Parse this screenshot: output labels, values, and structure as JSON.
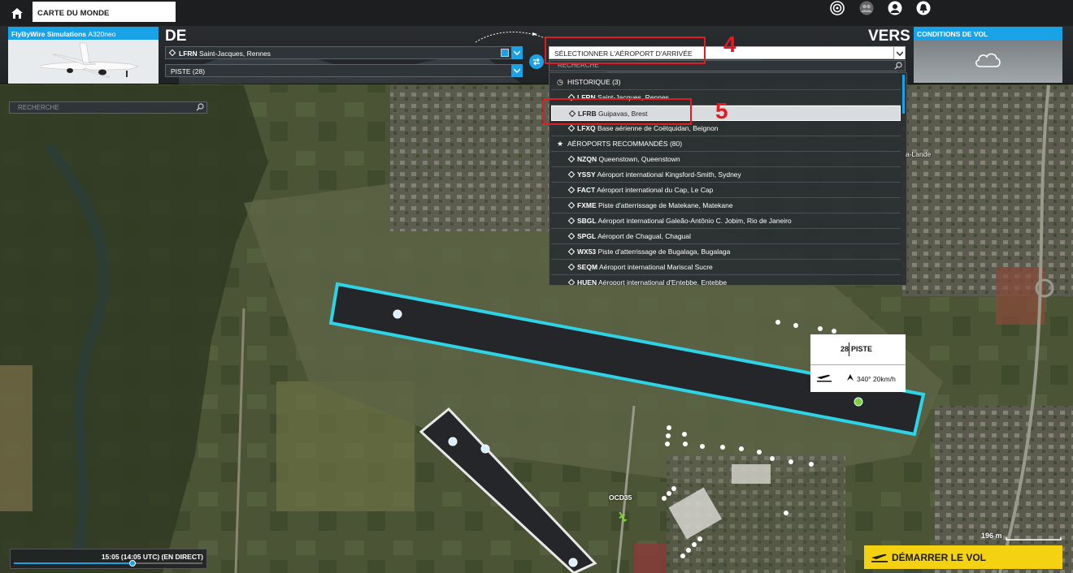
{
  "topbar": {
    "tab_label": "CARTE DU MONDE",
    "icons": [
      "home-icon",
      "activity-icon",
      "users-icon",
      "profile-icon",
      "notifications-icon"
    ]
  },
  "aircraft": {
    "maker": "FlyByWire Simulations",
    "model": "A320neo"
  },
  "departure": {
    "heading": "DE",
    "airport_icao": "LFRN",
    "airport_name": "Saint-Jacques, Rennes",
    "runway": "PISTE (28)"
  },
  "arrival": {
    "heading": "VERS",
    "select_label": "SÉLECTIONNER L'AÉROPORT D'ARRIVÉE",
    "search_placeholder": "RECHERCHE"
  },
  "dropdown": {
    "history_header": "HISTORIQUE (3)",
    "recommended_header": "AÉROPORTS RECOMMANDÉS (80)",
    "history": [
      {
        "icao": "LFRN",
        "name": "Saint-Jacques, Rennes"
      },
      {
        "icao": "LFRB",
        "name": "Guipavas, Brest"
      },
      {
        "icao": "LFXQ",
        "name": "Base aérienne de Coëtquidan, Beignon"
      }
    ],
    "recommended": [
      {
        "icao": "NZQN",
        "name": "Queenstown, Queenstown"
      },
      {
        "icao": "YSSY",
        "name": "Aéroport international Kingsford-Smith, Sydney"
      },
      {
        "icao": "FACT",
        "name": "Aéroport international du Cap, Le Cap"
      },
      {
        "icao": "FXME",
        "name": "Piste d'atterrissage de Matekane, Matekane"
      },
      {
        "icao": "SBGL",
        "name": "Aéroport international Galeão-Antônio C. Jobim, Rio de Janeiro"
      },
      {
        "icao": "SPGL",
        "name": "Aéroport de Chagual, Chagual"
      },
      {
        "icao": "WX53",
        "name": "Piste d'atterrissage de Bugalaga, Bugalaga"
      },
      {
        "icao": "SEQM",
        "name": "Aéroport international Mariscal Sucre"
      },
      {
        "icao": "HUEN",
        "name": "Aéroport international d'Entebbe, Entebbe"
      }
    ]
  },
  "conditions": {
    "title": "CONDITIONS DE VOL",
    "icon": "cloud-icon"
  },
  "annotations": {
    "step4": "4",
    "step5": "5"
  },
  "map": {
    "search_placeholder": "RECHERCHE",
    "place_label": "a-Lande",
    "secondary_runway_label": "OCD35",
    "scale": "196 m"
  },
  "runway_popup": {
    "number": "28",
    "label": "PISTE",
    "wind": "340° 20km/h"
  },
  "time": {
    "text": "15:05 (14:05 UTC) (EN DIRECT)",
    "progress": 0.63
  },
  "start_button": {
    "label": "DÉMARRER LE VOL"
  },
  "colors": {
    "accent": "#1aa2e6",
    "runway_outline": "#2fd3e6",
    "start_button": "#f5d211",
    "annotation": "#e01b22"
  }
}
